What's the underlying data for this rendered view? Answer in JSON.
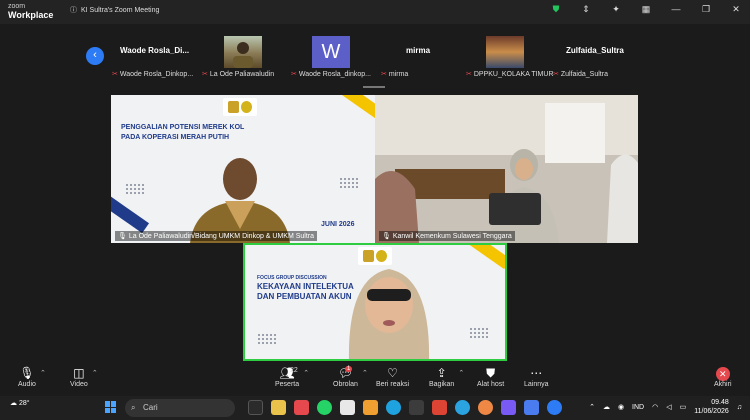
{
  "titlebar": {
    "brand_top": "zoom",
    "brand_bottom": "Workplace",
    "meeting_title": "KI Sultra's Zoom Meeting"
  },
  "strip": {
    "thumbs": [
      {
        "name": "Waode  Rosla_Di...",
        "type": "text"
      },
      {
        "name": "",
        "type": "photo"
      },
      {
        "name": "W",
        "type": "initial"
      },
      {
        "name": "mirma",
        "type": "text"
      },
      {
        "name": "",
        "type": "photo"
      },
      {
        "name": "Zulfaida_Sultra",
        "type": "text"
      }
    ],
    "subnames": [
      "Waode Rosla_Dinkop...",
      "La Ode Paliawaludin",
      "Waode Rosla_dinkop...",
      "mirma",
      "DPPKU_KOLAKA TIMUR",
      "Zulfaida_Sultra"
    ]
  },
  "videos": {
    "v1_banner_line1": "PENGGALIAN POTENSI  MEREK KOL",
    "v1_banner_line2": "PADA KOPERASI MERAH PUTIH",
    "v1_date": "JUNI 2026",
    "v1_label": "La Ode Paliawaludin/Bidang UMKM Dinkop & UMKM Sultra",
    "v2_label": "Kanwil Kemenkum Sulawesi Tenggara",
    "v3_banner_small": "FOCUS GROUP DISCUSSION",
    "v3_banner_line1": "KEKAYAAN INTELEKTUA",
    "v3_banner_line2": "DAN PEMBUATAN AKUN"
  },
  "toolbar": {
    "audio": "Audio",
    "video": "Video",
    "participants": "Peserta",
    "participants_count": "22",
    "chat": "Obrolan",
    "chat_badge": "1",
    "react": "Beri reaksi",
    "share": "Bagikan",
    "host_tools": "Alat host",
    "more": "Lainnya",
    "end": "Akhiri"
  },
  "taskbar": {
    "weather": "28°",
    "search_placeholder": "Cari",
    "lang": "IND",
    "time": "09.48",
    "date": "11/06/2026"
  },
  "colors": {
    "accent_blue": "#2d7cf6",
    "active_speaker": "#2ecc40",
    "danger": "#e5484d",
    "banner_text": "#1f3b8a"
  }
}
